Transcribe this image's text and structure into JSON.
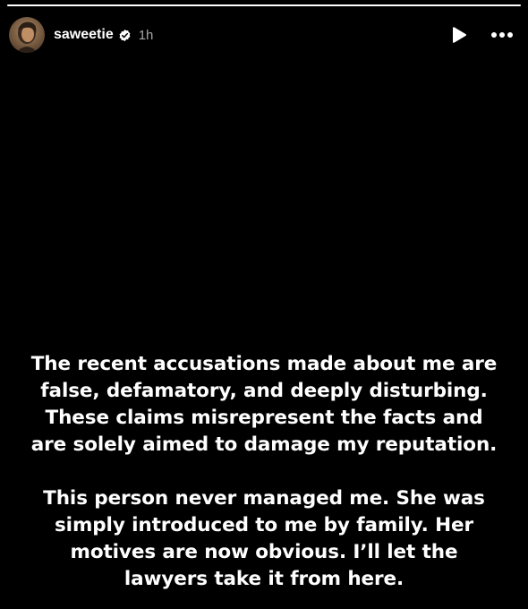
{
  "story": {
    "progress": 1.0,
    "progress_color": "#ffffff",
    "background_color": "#000000"
  },
  "header": {
    "username": "saweetie",
    "verified": true,
    "timestamp": "1h",
    "avatar_icon": "profile-photo",
    "play_icon": "play-icon",
    "more_icon": "more-options-icon"
  },
  "body": {
    "paragraph_1": "The recent accusations made about me are\nfalse, defamatory, and deeply disturbing.\nThese claims misrepresent the facts and\nare solely aimed to damage my reputation.",
    "paragraph_2": "This person never managed me. She was\nsimply introduced to me by family. Her\nmotives are now obvious. I’ll let the\nlawyers take it from here."
  }
}
